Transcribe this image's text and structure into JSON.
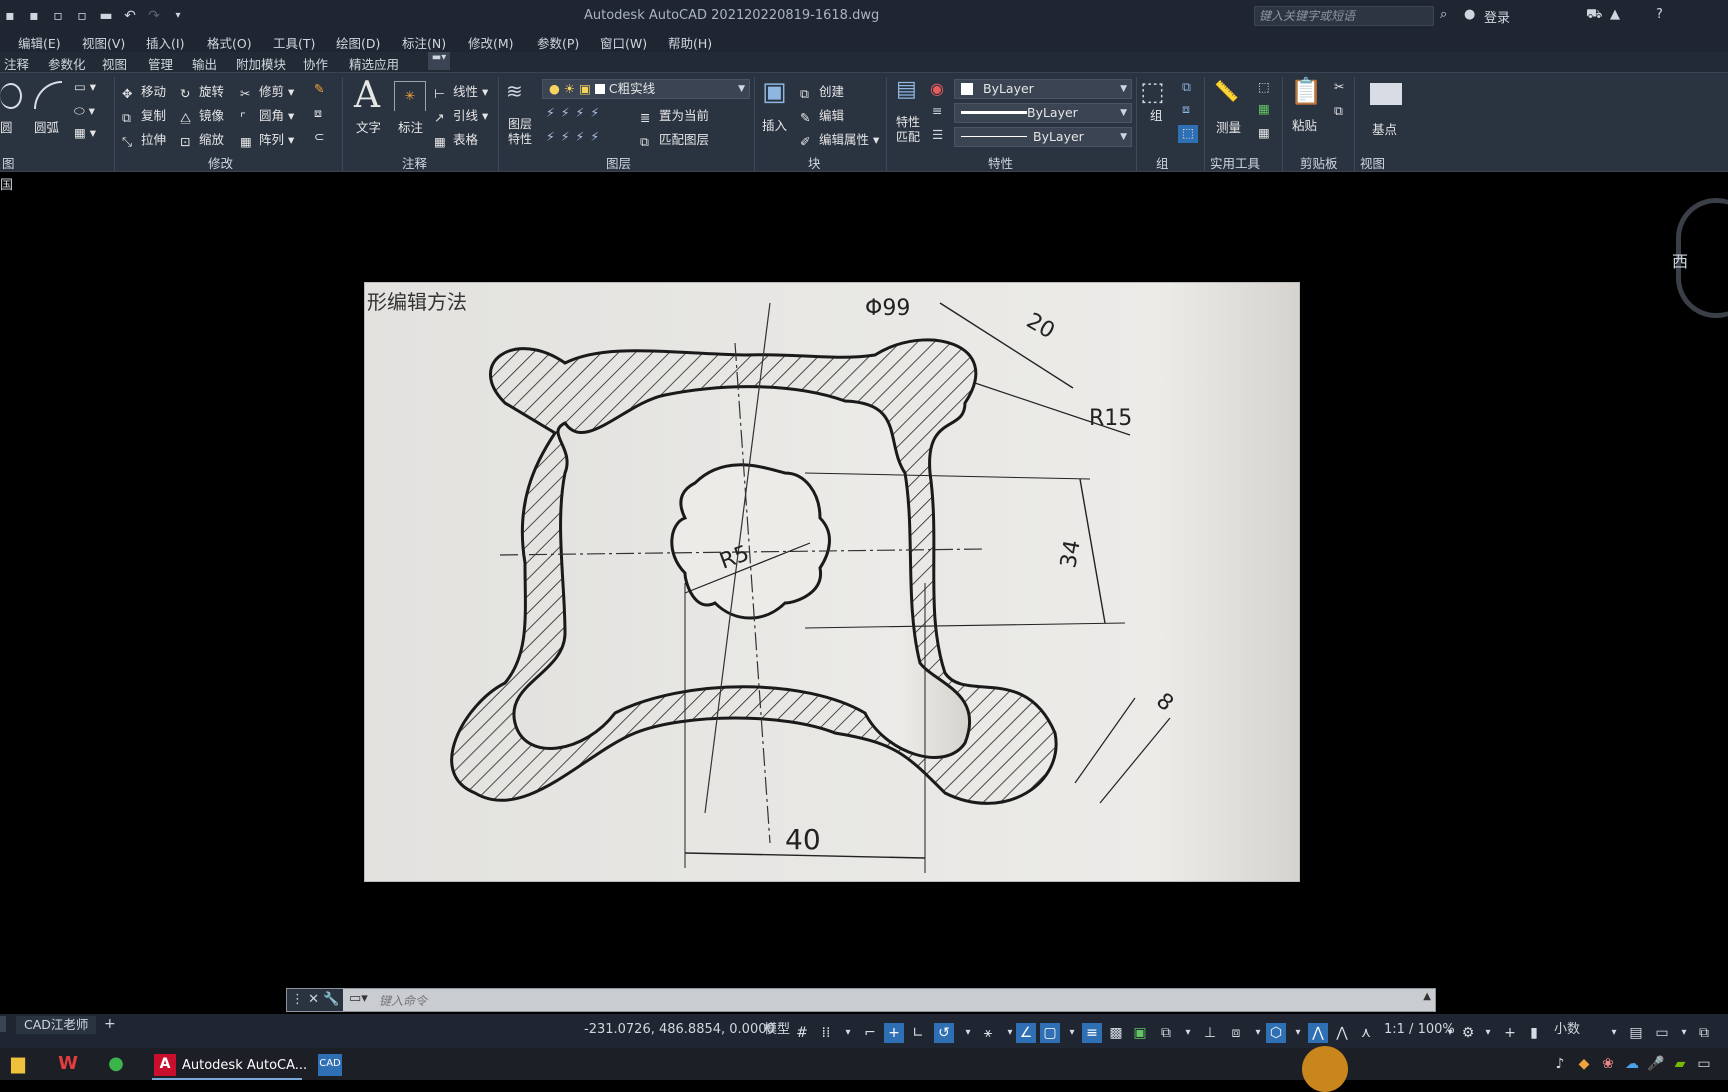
{
  "titlebar": {
    "app": "Autodesk AutoCAD 2021",
    "file": "20220819-1618.dwg",
    "search_placeholder": "键入关键字或短语",
    "login": "登录"
  },
  "menus": [
    "编辑(E)",
    "视图(V)",
    "插入(I)",
    "格式(O)",
    "工具(T)",
    "绘图(D)",
    "标注(N)",
    "修改(M)",
    "参数(P)",
    "窗口(W)",
    "帮助(H)"
  ],
  "ribbon_tabs": [
    "注释",
    "参数化",
    "视图",
    "管理",
    "输出",
    "附加模块",
    "协作",
    "精选应用"
  ],
  "ribbon": {
    "draw": {
      "circle": "圆",
      "arc": "圆弧",
      "panel": "图"
    },
    "modify": {
      "move": "移动",
      "rotate": "旋转",
      "trim": "修剪",
      "copy": "复制",
      "mirror": "镜像",
      "fillet": "圆角",
      "stretch": "拉伸",
      "scale": "缩放",
      "array": "阵列",
      "panel": "修改"
    },
    "annotation": {
      "text": "文字",
      "dim": "标注",
      "linear": "线性",
      "leader": "引线",
      "table": "表格",
      "panel": "注释"
    },
    "layers": {
      "props_line1": "图层",
      "props_line2": "特性",
      "current_layer": "C粗实线",
      "set_current": "置为当前",
      "match_layer": "匹配图层",
      "panel": "图层"
    },
    "block": {
      "insert": "插入",
      "create": "创建",
      "edit": "编辑",
      "edit_attr": "编辑属性",
      "panel": "块"
    },
    "properties": {
      "match_line1": "特性",
      "match_line2": "匹配",
      "color": "ByLayer",
      "linetype": "ByLayer",
      "lineweight": "ByLayer",
      "panel": "特性"
    },
    "groups": {
      "group": "组",
      "panel": "组"
    },
    "utilities": {
      "measure": "测量",
      "panel": "实用工具"
    },
    "clipboard": {
      "paste": "粘贴",
      "panel": "剪贴板"
    },
    "view": {
      "basepoint": "基点",
      "panel": "视图"
    }
  },
  "viewcube_label": "西",
  "file_tab_glyph": "国",
  "drawing": {
    "header_text": "形编辑方法",
    "dim_phi99": "Φ99",
    "dim_20": "20",
    "dim_r15": "R15",
    "dim_34": "34",
    "dim_r5": "R5",
    "dim_8": "8",
    "dim_40": "40"
  },
  "command": {
    "placeholder": "键入命令"
  },
  "layout_tabs": [
    "CAD江老师",
    "+"
  ],
  "status": {
    "coords": "-231.0726, 486.8854, 0.0000",
    "model": "模型",
    "scale": "1:1 / 100%",
    "units": "小数"
  },
  "taskbar": {
    "autocad_label": "Autodesk AutoCA..."
  }
}
